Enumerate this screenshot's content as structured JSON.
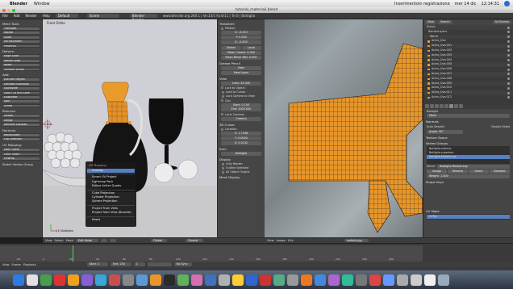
{
  "mac_menubar": {
    "items": [
      "Blender",
      "Window"
    ],
    "right_items": [
      "Inserimentoin registrazione",
      "mer 14 dic",
      "12:14:31"
    ]
  },
  "window": {
    "title": "tutorial_materiali.blend"
  },
  "info_header": {
    "menus": [
      "File",
      "Add",
      "Render",
      "Help"
    ],
    "layout": "Default",
    "scene": "Scene",
    "engine": "Blender Render",
    "stats": "www.blender.org 260.1 | Ve:23/1 Fa:0/11 | Tri:0 | Bottiglia"
  },
  "tool_shelf": {
    "section1": "Mesh Tools",
    "group_transform": [
      "Translate",
      "Rotate",
      "Scale",
      "Shrink/Fatten",
      "Push/Pull"
    ],
    "deform_label": "Deform:",
    "group_deform": [
      "Edge Slide",
      "Vertex Slide",
      "Noise",
      "Smooth Vertex"
    ],
    "add_label": "Add:",
    "group_add": [
      "Extrude Region",
      "Extrude Individual",
      "Subdivide",
      "Loop Cut and Slide",
      "Duplicate",
      "Spin",
      "Screw"
    ],
    "remove_label": "Remove:",
    "group_remove": [
      "Delete",
      "Merge",
      "Remove Doubles"
    ],
    "normals_label": "Normals:",
    "group_normals": [
      "Recalculate",
      "Flip Direction"
    ],
    "uv_label": "UV Mapping:",
    "group_uv": [
      "Mark Seam",
      "Clear Seam",
      "Unwrap"
    ],
    "bottom": "Select Vertex Group"
  },
  "view3d": {
    "label": "Front Ortho",
    "object_label": "(1) Bottiglia"
  },
  "uv_menu": {
    "header": "UV Mapping",
    "items": [
      "Unwrap",
      "Smart UV Project",
      "Lightmap Pack",
      "Follow Active Quads",
      "Cube Projection",
      "Cylinder Projection",
      "Sphere Projection",
      "Project From View",
      "Project from View (Bounds)",
      "Reset"
    ],
    "highlighted": "Unwrap"
  },
  "n_panel": {
    "transform_header": "Transform",
    "median": "Median:",
    "x": "X: -0.253",
    "y": "Y: 0.000",
    "z": "Z: -0.000",
    "global": "Global",
    "local": "Local",
    "mean_crease": "Mean Crease: 0.000",
    "mean_bevel": "Mean Bevel Wei: 0.000",
    "grease_header": "Grease Pencil",
    "new": "New",
    "new_layer": "New Layer",
    "view_header": "View",
    "lens": "Lens: 35.000",
    "lock_object": "Lock to Object:",
    "lock_cursor": "Lock to Cursor",
    "lock_camera": "Lock Camera to View",
    "clip": "Clip:",
    "clip_start": "Start: 0.100",
    "clip_end": "End: 1000.000",
    "local_camera": "Local Camera:",
    "camera": "Camera",
    "cursor_header": "3D Cursor",
    "location": "Location:",
    "cx": "X: 1.7548",
    "cy": "Y: 0.0004",
    "cz": "Z: 0.3132",
    "item_header": "Item",
    "item_name": "Bottiglia",
    "display_header": "Display",
    "only_render": "Only Render",
    "outline": "Outline Selected",
    "all_edges": "All Object Origins",
    "mesh_display": "Mesh Display"
  },
  "outliner": {
    "view": "View",
    "search": "Search",
    "filter": "All Scenes",
    "rows": [
      "Scene",
      "RenderLayers",
      "World",
      "Acino_Uva",
      "Acino_Uva.001",
      "Acino_Uva.002",
      "Acino_Uva.003",
      "Acino_Uva.004",
      "Acino_Uva.005",
      "Acino_Uva.006",
      "Acino_Uva.007",
      "Acino_Uva.008",
      "Acino_Uva.009",
      "Acino_Uva.010",
      "Acino_Uva.011",
      "Acino_Uva.012"
    ]
  },
  "properties": {
    "object_name": "Bottiglia",
    "mesh_label": "Mesh",
    "normals_header": "Normals",
    "auto_smooth": "Auto Smooth",
    "double_sided": "Double Sided",
    "angle": "Angle: 30°",
    "texture_space": "Texture Space",
    "vertex_groups": "Vertex Groups",
    "groups": [
      "Bottiglia-esterno",
      "Bottiglia-superiore",
      "Bottiglia-Metallo-top"
    ],
    "weight_label": "Name:",
    "weight_value": "Bottiglia-Metallo-top",
    "assign": "Assign",
    "remove": "Remove",
    "select": "Select",
    "deselect": "Deselect",
    "weight": "Weight: 1.000",
    "shape_keys": "Shape Keys",
    "uv_maps": "UV Maps",
    "uv_item": "UVTex"
  },
  "header_3d": {
    "menus": [
      "View",
      "Select",
      "Mesh"
    ],
    "mode": "Edit Mode",
    "orientation": "Global",
    "pivot": "Closest"
  },
  "header_uv": {
    "menus": [
      "View",
      "Image",
      "UVs"
    ],
    "image": "metallo.jpg"
  },
  "timeline": {
    "menus": [
      "View",
      "Frame",
      "Playback"
    ],
    "start": "Start: 1",
    "end": "End: 250",
    "current": "1",
    "no_sync": "No Sync",
    "ticks": [
      "-20",
      "0",
      "20",
      "40",
      "60",
      "80",
      "100",
      "120",
      "140",
      "160",
      "180",
      "200",
      "220",
      "240",
      "260"
    ]
  },
  "colors": {
    "orange": "#e8962a",
    "highlight": "#5680c2",
    "mesh_wire": "#1a1a1a"
  }
}
